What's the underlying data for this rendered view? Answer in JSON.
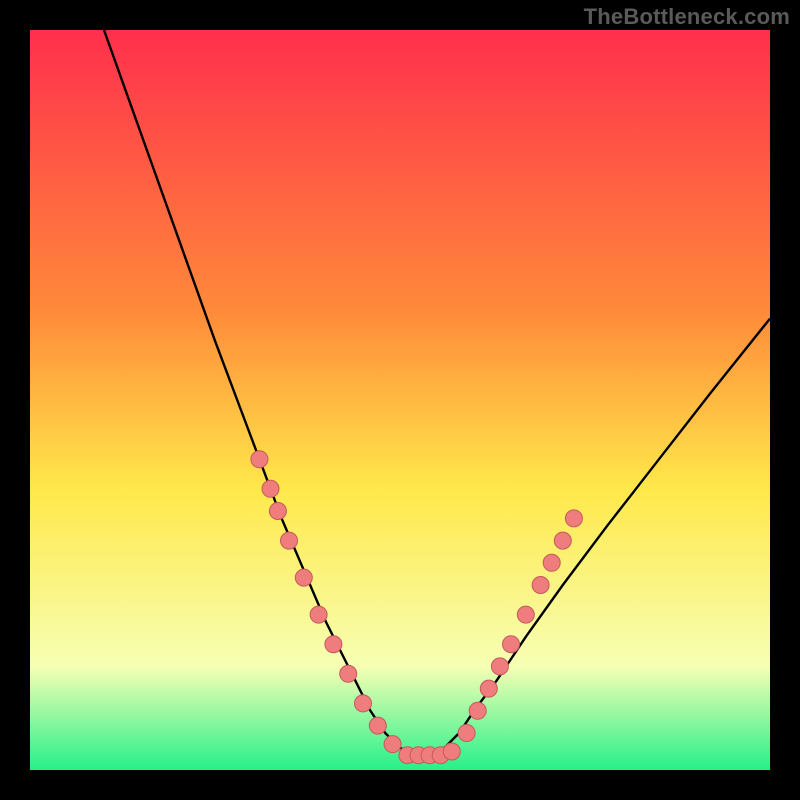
{
  "watermark": "TheBottleneck.com",
  "colors": {
    "background": "#000000",
    "curve": "#000000",
    "marker_fill": "#ef7d7d",
    "marker_stroke": "#c55a5a",
    "grad_top": "#ff2f4c",
    "grad_mid1": "#ff8a3a",
    "grad_mid2": "#ffe84a",
    "grad_mid3": "#f6ffb4",
    "grad_bottom": "#26f08a"
  },
  "chart_data": {
    "type": "line",
    "title": "",
    "xlabel": "",
    "ylabel": "",
    "xlim": [
      0,
      100
    ],
    "ylim": [
      0,
      100
    ],
    "grid": false,
    "legend": false,
    "series": [
      {
        "name": "curve",
        "x": [
          10,
          15,
          20,
          25,
          28,
          31,
          34,
          37,
          40,
          42,
          44,
          46,
          48,
          50,
          52,
          54,
          56,
          58,
          60,
          63,
          67,
          72,
          78,
          85,
          92,
          100
        ],
        "y": [
          100,
          86,
          72,
          58,
          50,
          42,
          34,
          27,
          20,
          16,
          12,
          8,
          5,
          3,
          2,
          2,
          3,
          5,
          8,
          12,
          18,
          25,
          33,
          42,
          51,
          61
        ]
      }
    ],
    "markers": {
      "left_branch": [
        {
          "x": 31,
          "y": 42
        },
        {
          "x": 32.5,
          "y": 38
        },
        {
          "x": 33.5,
          "y": 35
        },
        {
          "x": 35,
          "y": 31
        },
        {
          "x": 37,
          "y": 26
        },
        {
          "x": 39,
          "y": 21
        },
        {
          "x": 41,
          "y": 17
        },
        {
          "x": 43,
          "y": 13
        },
        {
          "x": 45,
          "y": 9
        },
        {
          "x": 47,
          "y": 6
        },
        {
          "x": 49,
          "y": 3.5
        }
      ],
      "valley": [
        {
          "x": 51,
          "y": 2
        },
        {
          "x": 52.5,
          "y": 2
        },
        {
          "x": 54,
          "y": 2
        },
        {
          "x": 55.5,
          "y": 2
        },
        {
          "x": 57,
          "y": 2.5
        }
      ],
      "right_branch": [
        {
          "x": 59,
          "y": 5
        },
        {
          "x": 60.5,
          "y": 8
        },
        {
          "x": 62,
          "y": 11
        },
        {
          "x": 63.5,
          "y": 14
        },
        {
          "x": 65,
          "y": 17
        },
        {
          "x": 67,
          "y": 21
        },
        {
          "x": 69,
          "y": 25
        },
        {
          "x": 70.5,
          "y": 28
        },
        {
          "x": 72,
          "y": 31
        },
        {
          "x": 73.5,
          "y": 34
        }
      ]
    }
  }
}
